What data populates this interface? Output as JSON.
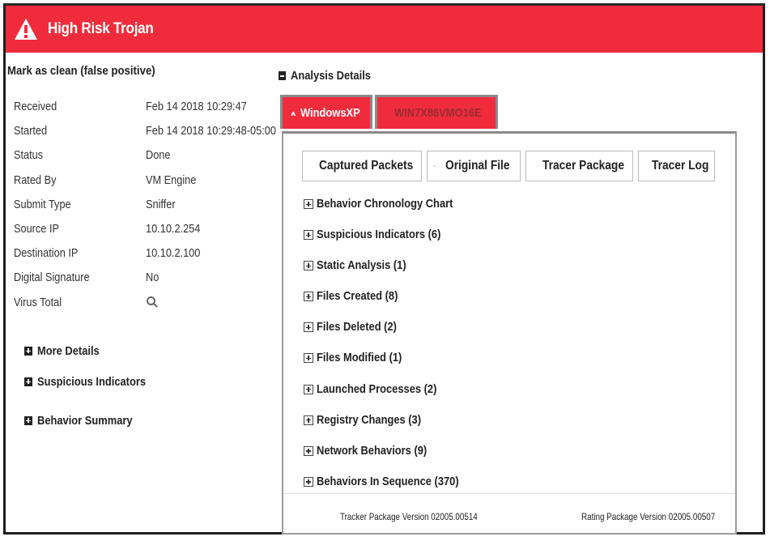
{
  "header": {
    "icon": "warning-triangle-icon",
    "title": "High Risk Trojan",
    "color": "#f02c3c"
  },
  "mark_clean_label": "Mark as clean (false positive)",
  "info": [
    {
      "key": "Received",
      "value": "Feb 14 2018 10:29:47"
    },
    {
      "key": "Started",
      "value": "Feb 14 2018 10:29:48-05:00"
    },
    {
      "key": "Status",
      "value": "Done"
    },
    {
      "key": "Rated By",
      "value": "VM Engine"
    },
    {
      "key": "Submit Type",
      "value": "Sniffer"
    },
    {
      "key": "Source IP",
      "value": "10.10.2.254"
    },
    {
      "key": "Destination IP",
      "value": "10.10.2.100"
    },
    {
      "key": "Digital Signature",
      "value": "No"
    },
    {
      "key": "Virus Total",
      "value_icon": "search-icon"
    }
  ],
  "left_sections": [
    {
      "label": "More Details"
    },
    {
      "label": "Suspicious Indicators"
    },
    {
      "label": "Behavior Summary"
    }
  ],
  "analysis": {
    "title": "Analysis Details",
    "tabs": [
      {
        "label": "WindowsXP",
        "active": true
      },
      {
        "label": "WIN7X86VMO16E",
        "active": false
      }
    ],
    "buttons": [
      {
        "label": "Captured Packets",
        "icon": "download-icon"
      },
      {
        "label": "Original File",
        "icon": "download-icon"
      },
      {
        "label": "Tracer Package",
        "icon": "download-icon"
      },
      {
        "label": "Tracer Log",
        "icon": "download-icon"
      }
    ],
    "sections": [
      {
        "label": "Behavior Chronology Chart"
      },
      {
        "label": "Suspicious Indicators (6)"
      },
      {
        "label": "Static Analysis (1)"
      },
      {
        "label": "Files Created (8)"
      },
      {
        "label": "Files Deleted (2)"
      },
      {
        "label": "Files Modified (1)"
      },
      {
        "label": "Launched Processes (2)"
      },
      {
        "label": "Registry Changes (3)"
      },
      {
        "label": "Network Behaviors (9)"
      },
      {
        "label": "Behaviors In Sequence (370)"
      }
    ],
    "footer": {
      "tracker_version": "Tracker Package Version 02005.00514",
      "rating_version": "Rating Package Version 02005.00507"
    }
  }
}
